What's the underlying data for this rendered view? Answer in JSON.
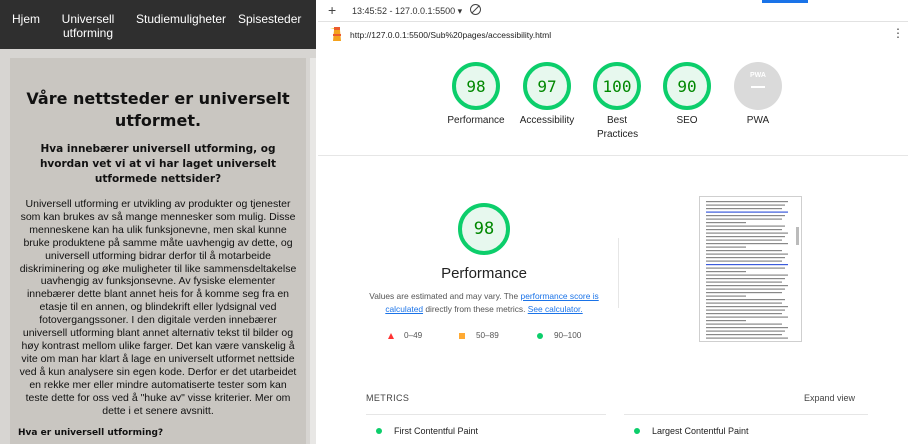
{
  "site": {
    "nav": [
      "Hjem",
      "Universell utforming",
      "Studiemuligheter",
      "Spisesteder"
    ],
    "title": "Våre nettsteder er universelt utformet.",
    "subtitle": "Hva innebærer universell utforming, og hvordan vet vi at vi har laget universelt utformede nettsider?",
    "body": "Universell utforming er utvikling av produkter og tjenester som kan brukes av så mange mennesker som mulig. Disse menneskene kan ha ulik funksjonevne, men skal kunne bruke produktene på samme måte uavhengig av dette, og universell utforming bidrar derfor til å motarbeide diskriminering og øke muligheter til like sammensdeltakelse uavhengig av funksjonsevne. Av fysiske elementer innebærer dette blant annet heis for å komme seg fra en etasje til en annen, og blindekrift eller lydsignal ved fotovergangssoner. I den digitale verden innebærer universell utforming blant annet alternativ tekst til bilder og høy kontrast mellom ulike farger. Det kan være vanskelig å vite om man har klart å lage en universelt utformet nettside ved å kun analysere sin egen kode. Derfor er det utarbeidet en rekke mer eller mindre automatiserte tester som kan teste dette for oss ved å \"huke av\" visse kriterier. Mer om dette i et senere avsnitt.",
    "next_heading": "Hva er universell utforming?"
  },
  "devtools": {
    "time": "13:45:52 - 127.0.0.1:5500",
    "url": "http://127.0.0.1:5500/Sub%20pages/accessibility.html",
    "scores": [
      {
        "label": "Performance",
        "value": "98"
      },
      {
        "label": "Accessibility",
        "value": "97"
      },
      {
        "label": "Best Practices",
        "value": "100"
      },
      {
        "label": "SEO",
        "value": "90"
      }
    ],
    "pwa": {
      "badge": "PWA",
      "label": "PWA"
    },
    "main_score": "98",
    "main_title": "Performance",
    "note_pre": "Values are estimated and may vary. The ",
    "note_link1": "performance score is calculated",
    "note_mid": " directly from these metrics. ",
    "note_link2": "See calculator.",
    "legend": [
      "0–49",
      "50–89",
      "90–100"
    ],
    "metrics_header": "METRICS",
    "expand": "Expand view",
    "metrics": [
      "First Contentful Paint",
      "Largest Contentful Paint"
    ],
    "colors": {
      "pass": "#0cce6b",
      "average": "#ffaa33",
      "fail": "#ff3333",
      "link": "#1a73e8"
    }
  }
}
